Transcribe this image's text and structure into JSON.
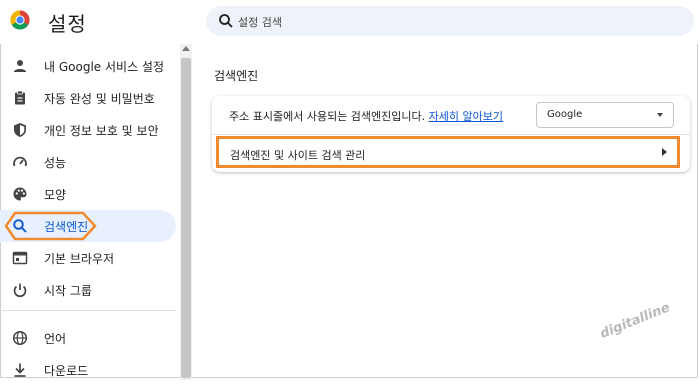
{
  "header": {
    "title": "설정",
    "search_placeholder": "설정 검색",
    "logo_icon": "chrome-logo-icon"
  },
  "sidebar": {
    "items": [
      {
        "label": "내 Google 서비스 설정",
        "icon": "person-icon"
      },
      {
        "label": "자동 완성 및 비밀번호",
        "icon": "clipboard-icon"
      },
      {
        "label": "개인 정보 보호 및 보안",
        "icon": "shield-icon"
      },
      {
        "label": "성능",
        "icon": "speedometer-icon"
      },
      {
        "label": "모양",
        "icon": "palette-icon"
      },
      {
        "label": "검색엔진",
        "icon": "search-icon",
        "active": true
      },
      {
        "label": "기본 브라우저",
        "icon": "browser-window-icon"
      },
      {
        "label": "시작 그룹",
        "icon": "power-icon"
      },
      {
        "label": "언어",
        "icon": "globe-icon"
      },
      {
        "label": "다운로드",
        "icon": "download-icon"
      }
    ]
  },
  "main": {
    "section_title": "검색엔진",
    "row1": {
      "text": "주소 표시줄에서 사용되는 검색엔진입니다.",
      "link": "자세히 알아보기",
      "select_value": "Google"
    },
    "row2": {
      "text": "검색엔진 및 사이트 검색 관리"
    }
  },
  "watermark": "digitalline",
  "colors": {
    "accent": "#0b57d0",
    "active_bg": "#e8f0fe",
    "highlight": "#f08a2c"
  }
}
